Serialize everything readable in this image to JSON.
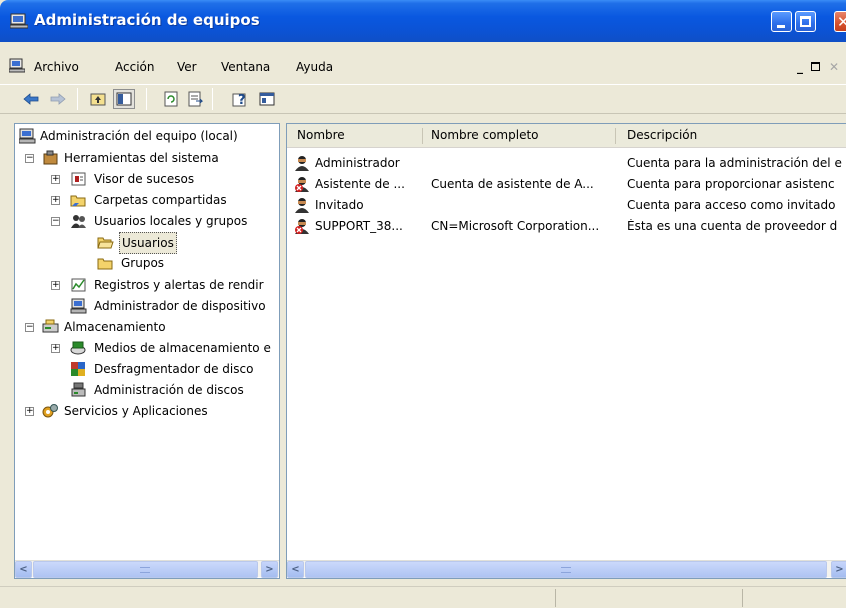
{
  "window": {
    "title": "Administración de equipos"
  },
  "menu": [
    "Archivo",
    "Acción",
    "Ver",
    "Ventana",
    "Ayuda"
  ],
  "toolbar": {
    "buttons": [
      "back-icon",
      "forward-icon",
      "up-folder-icon",
      "show-hide-tree-icon",
      "refresh-icon",
      "export-list-icon",
      "help-icon",
      "properties-icon"
    ]
  },
  "tree": {
    "root": "Administración del equipo (local)",
    "items": [
      "Herramientas del sistema",
      "Visor de sucesos",
      "Carpetas compartidas",
      "Usuarios locales y grupos",
      "Usuarios",
      "Grupos",
      "Registros y alertas de rendir",
      "Administrador de dispositivo",
      "Almacenamiento",
      "Medios de almacenamiento e",
      "Desfragmentador de disco",
      "Administración de discos",
      "Servicios y Aplicaciones"
    ]
  },
  "list": {
    "columns": [
      "Nombre",
      "Nombre completo",
      "Descripción"
    ],
    "rows": [
      {
        "name": "Administrador",
        "full": "",
        "desc": "Cuenta para la administración del e"
      },
      {
        "name": "Asistente de ...",
        "full": "Cuenta de asistente de A...",
        "desc": "Cuenta para proporcionar asistenc"
      },
      {
        "name": "Invitado",
        "full": "",
        "desc": "Cuenta para acceso como invitado"
      },
      {
        "name": "SUPPORT_38...",
        "full": "CN=Microsoft Corporation...",
        "desc": "Ésta es una cuenta de proveedor d"
      }
    ]
  },
  "colors": {
    "titlebar": "#0b53d6",
    "chrome": "#ece9d8",
    "selection": "#ece9d8"
  }
}
